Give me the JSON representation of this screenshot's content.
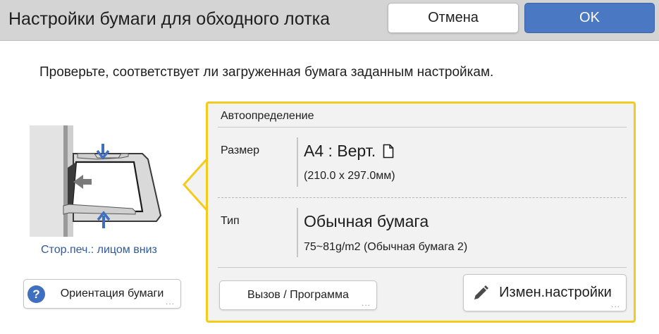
{
  "header": {
    "title": "Настройки бумаги для обходного лотка",
    "cancel_label": "Отмена",
    "ok_label": "OK"
  },
  "instruction": "Проверьте, соответствует ли загруженная бумага заданным настройкам.",
  "illustration": {
    "caption": "Стор.печ.: лицом вниз"
  },
  "orientation_button": {
    "help_glyph": "?",
    "label": "Ориентация бумаги"
  },
  "panel": {
    "header": "Автоопределение",
    "size": {
      "label": "Размер",
      "value": "A4 : Верт.",
      "detail": "(210.0 x 297.0мм)",
      "icon": "portrait-page-icon"
    },
    "type": {
      "label": "Тип",
      "value": "Обычная бумага",
      "detail": "75~81g/m2 (Обычная бумага 2)"
    },
    "recall_button_label": "Вызов / Программа",
    "change_button_label": "Измен.настройки"
  },
  "more_indicator": "...",
  "colors": {
    "accent_blue": "#4a78c2",
    "highlight_yellow": "#f2cb1d",
    "caption_blue": "#2f5a9e",
    "titlebar_grey": "#d4d4d4"
  }
}
